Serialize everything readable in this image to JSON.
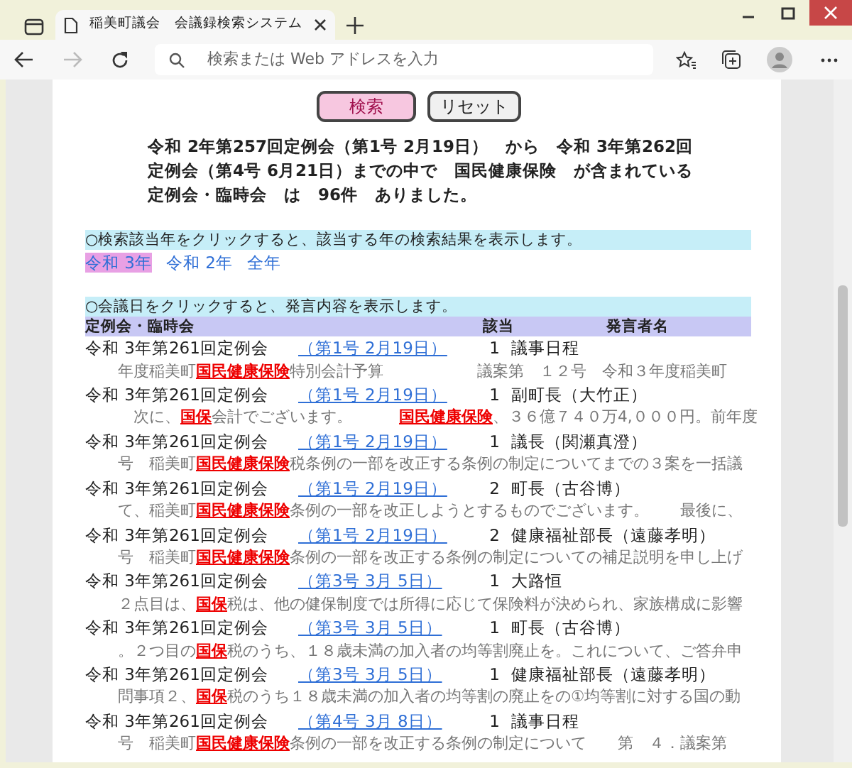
{
  "browser": {
    "tab_title": "稲美町議会　会議録検索システム",
    "address_placeholder": "検索または Web アドレスを入力"
  },
  "buttons": [
    {
      "label": "検索",
      "kind": "primary"
    },
    {
      "label": "リセット",
      "kind": "secondary"
    }
  ],
  "summary": "令和 2年第257回定例会（第1号 2月19日）　から　令和 3年第262回定例会（第4号 6月21日）までの中で　国民健康保険　が含まれている定例会・臨時会　は　96件　ありました。",
  "year_filter": {
    "notice": "○検索該当年をクリックすると、該当する年の検索結果を表示します。",
    "years": [
      {
        "label": "令和 3年",
        "selected": true
      },
      {
        "label": "令和 2年",
        "selected": false
      },
      {
        "label": "全年",
        "selected": false
      }
    ]
  },
  "results": {
    "notice": "○会議日をクリックすると、発言内容を表示します。",
    "columns": [
      "定例会・臨時会",
      "該当",
      "発言者名"
    ],
    "rows": [
      {
        "meeting": "令和 3年第261回定例会",
        "date": "（第1号 2月19日）",
        "count": "1",
        "speaker": "議事日程",
        "snippet": "年度稲美町**国民健康保険**特別会計予算　　　　　　議案第　１２号　令和３年度稲美町"
      },
      {
        "meeting": "令和 3年第261回定例会",
        "date": "（第1号 2月19日）",
        "count": "1",
        "speaker": "副町長（大竹正）",
        "snippet": "　次に、**国保**会計でございます。　　　**国民健康保険**、３６億７４０万4,０００円。前年度"
      },
      {
        "meeting": "令和 3年第261回定例会",
        "date": "（第1号 2月19日）",
        "count": "1",
        "speaker": "議長（関瀬真澄）",
        "snippet": "号　稲美町**国民健康保険**税条例の一部を改正する条例の制定についてまでの３案を一括議"
      },
      {
        "meeting": "令和 3年第261回定例会",
        "date": "（第1号 2月19日）",
        "count": "2",
        "speaker": "町長（古谷博）",
        "snippet": "て、稲美町**国民健康保険**条例の一部を改正しようとするものでございます。　　最後に、"
      },
      {
        "meeting": "令和 3年第261回定例会",
        "date": "（第1号 2月19日）",
        "count": "2",
        "speaker": "健康福祉部長（遠藤孝明）",
        "snippet": "号　稲美町**国民健康保険**条例の一部を改正する条例の制定についての補足説明を申し上げ"
      },
      {
        "meeting": "令和 3年第261回定例会",
        "date": "（第3号 3月 5日）",
        "count": "1",
        "speaker": "大路恒",
        "snippet": "２点目は、**国保**税は、他の健保制度では所得に応じて保険料が決められ、家族構成に影響"
      },
      {
        "meeting": "令和 3年第261回定例会",
        "date": "（第3号 3月 5日）",
        "count": "1",
        "speaker": "町長（古谷博）",
        "snippet": "。２つ目の**国保**税のうち、１８歳未満の加入者の均等割廃止を。これについて、ご答弁申"
      },
      {
        "meeting": "令和 3年第261回定例会",
        "date": "（第3号 3月 5日）",
        "count": "1",
        "speaker": "健康福祉部長（遠藤孝明）",
        "snippet": "問事項２、**国保**税のうち１８歳未満の加入者の均等割の廃止をの①均等割に対する国の動"
      },
      {
        "meeting": "令和 3年第261回定例会",
        "date": "（第4号 3月 8日）",
        "count": "1",
        "speaker": "議事日程",
        "snippet": "号　稲美町**国民健康保険**条例の一部を改正する条例の制定について　　第　４．議案第"
      }
    ]
  }
}
